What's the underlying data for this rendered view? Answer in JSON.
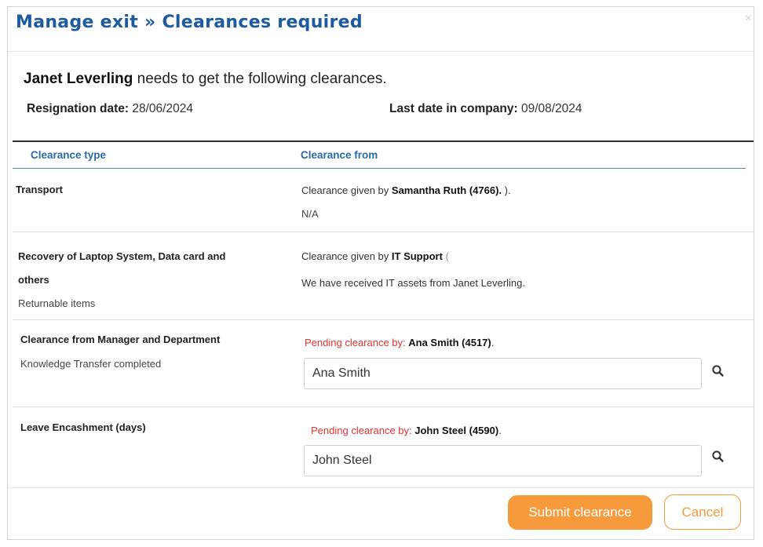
{
  "dialog": {
    "title": "Manage exit »  Clearances required",
    "close_glyph": "×"
  },
  "intro": {
    "employee_name": "Janet Leverling",
    "text": " needs to get the following clearances."
  },
  "dates": {
    "resignation_label": "Resignation date:",
    "resignation_value": "28/06/2024",
    "last_date_label": "Last date in company:",
    "last_date_value": "09/08/2024"
  },
  "table": {
    "headers": [
      "Clearance type",
      "Clearance from"
    ],
    "rows": [
      {
        "type": "Transport",
        "subtext": "",
        "from_prefix": "Clearance given by ",
        "from_name": "Samantha Ruth (4766).",
        "from_suffix": " ).",
        "note": "N/A"
      },
      {
        "type_line1": "Recovery of Laptop System, Data card and",
        "type_line2": "others",
        "subtext": "Returnable items",
        "from_prefix": "Clearance given by ",
        "from_name": "IT Support",
        "from_suffix": " (",
        "note": "We have received IT assets from Janet Leverling."
      },
      {
        "type": "Clearance from Manager and Department",
        "subtext": "Knowledge Transfer completed",
        "pending_label": "Pending clearance by: ",
        "pending_name": "Ana Smith (4517)",
        "pending_suffix": ".",
        "input_value": "Ana Smith"
      },
      {
        "type": "Leave Encashment (days)",
        "subtext": "",
        "pending_label": "Pending clearance by: ",
        "pending_name": "John Steel (4590)",
        "pending_suffix": ".",
        "input_value": "John Steel"
      }
    ]
  },
  "buttons": {
    "submit": "Submit clearance",
    "cancel": "Cancel"
  },
  "icons": {
    "search": "search-icon",
    "close": "close-icon"
  },
  "colors": {
    "title": "#1e5aa0",
    "header": "#2a69a8",
    "pending": "#e8322d",
    "accent": "#f79a3c"
  }
}
